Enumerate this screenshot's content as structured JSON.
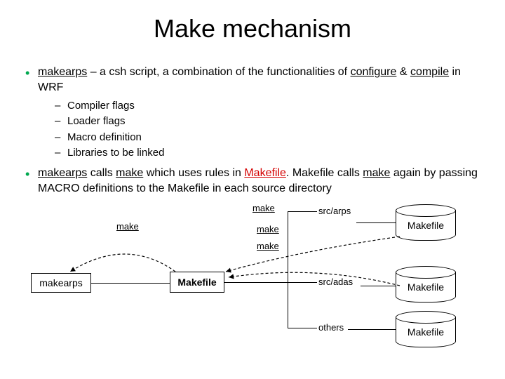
{
  "title": "Make mechanism",
  "bullet1": {
    "prefix": "makearps",
    "text_a": " – a csh script, a combination of the functionalities of ",
    "conf": "configure",
    "amp": " & ",
    "comp": "compile",
    "text_b": " in WRF",
    "sub": [
      "Compiler flags",
      "Loader flags",
      "Macro definition",
      "Libraries to be linked"
    ]
  },
  "bullet2": {
    "a": "makearps",
    "b": " calls ",
    "c": "make",
    "d": " which uses rules in ",
    "e": "Makefile",
    "f": ". Makefile calls ",
    "g": "make",
    "h": " again by passing MACRO definitions to the Makefile in each source directory"
  },
  "diagram": {
    "makearps": "makearps",
    "makefile": "Makefile",
    "make_label": "make",
    "dirs": [
      "src/arps",
      "src/adas",
      "others"
    ],
    "cyl": "Makefile"
  }
}
